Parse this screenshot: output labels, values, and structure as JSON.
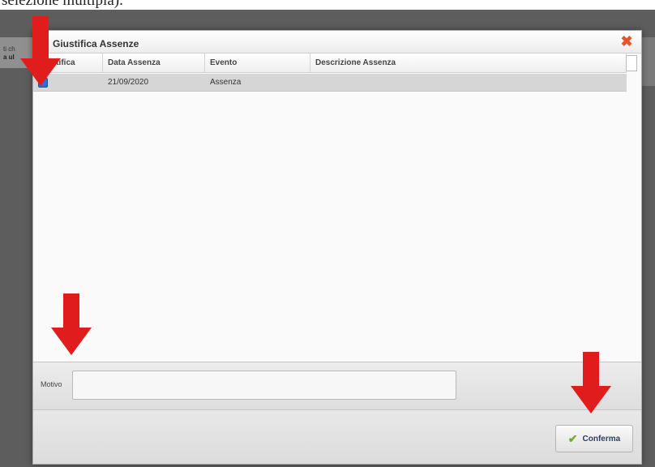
{
  "document": {
    "caption": "selezione multipla)."
  },
  "background": {
    "text_1": "ti ch",
    "text_2": "a ul"
  },
  "dialog": {
    "title": "Giustifica Assenze",
    "close_glyph": "✖",
    "columns": [
      "Giustifica",
      "Data Assenza",
      "Evento",
      "Descrizione Assenza"
    ],
    "rows": [
      {
        "checked": true,
        "date": "21/09/2020",
        "event": "Assenza",
        "description": ""
      }
    ],
    "motivo_label": "Motivo",
    "motivo_value": "",
    "confirm_label": "Conferma"
  },
  "colors": {
    "arrow": "#e11c1c",
    "close": "#e8542a",
    "check": "#67b12a"
  }
}
